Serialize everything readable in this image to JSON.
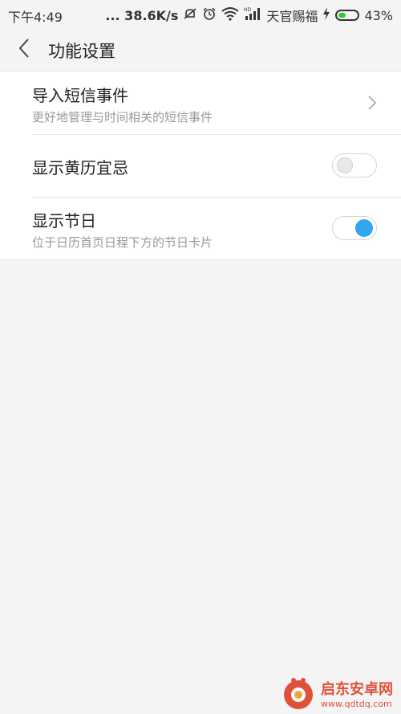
{
  "status_bar": {
    "time": "下午4:49",
    "network_speed": "... 38.6K/s",
    "carrier": "天官赐福",
    "battery_percent": "43%",
    "battery_level": 0.43,
    "icons": [
      "mute-icon",
      "alarm-icon",
      "wifi-icon",
      "hd-signal-icon",
      "charging-icon",
      "battery-icon"
    ]
  },
  "header": {
    "title": "功能设置",
    "back_icon": "chevron-left-icon"
  },
  "settings": [
    {
      "title": "导入短信事件",
      "subtitle": "更好地管理与时间相关的短信事件",
      "control": "chevron-right-icon"
    },
    {
      "title": "显示黄历宜忌",
      "subtitle": "",
      "control": "toggle",
      "enabled": false
    },
    {
      "title": "显示节日",
      "subtitle": "位于日历首页日程下方的节日卡片",
      "control": "toggle",
      "enabled": true
    }
  ],
  "colors": {
    "toggle_on": "#2fa6ee",
    "battery": "#2bcf2b",
    "watermark": "#e0513a"
  },
  "watermark": {
    "name": "启东安卓网",
    "url": "www.qdtdq.com"
  }
}
